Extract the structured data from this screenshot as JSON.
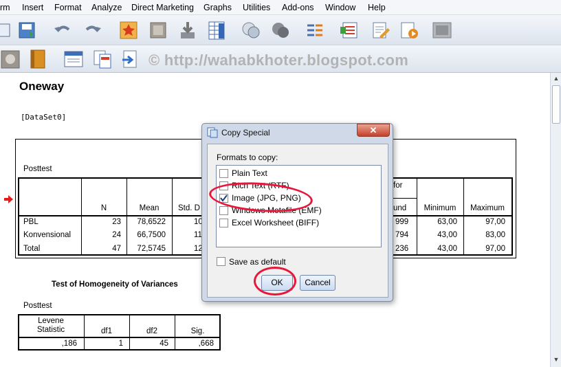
{
  "menu": [
    "rm",
    "Insert",
    "Format",
    "Analyze",
    "Direct Marketing",
    "Graphs",
    "Utilities",
    "Add-ons",
    "Window",
    "Help"
  ],
  "watermark": "© http://wahabkhoter.blogspot.com",
  "output": {
    "heading": "Oneway",
    "dataset": "[DataSet0]",
    "desc_table": {
      "title": "Posttest",
      "header_visible": [
        "N",
        "Mean",
        "Std. D",
        "for",
        "und",
        "Minimum",
        "Maximum"
      ],
      "rows": [
        {
          "label": "PBL",
          "n": "23",
          "mean": "78,6522",
          "std": "10",
          "upper": "999",
          "min": "63,00",
          "max": "97,00"
        },
        {
          "label": "Konvensional",
          "n": "24",
          "mean": "66,7500",
          "std": "11",
          "upper": "794",
          "min": "43,00",
          "max": "83,00"
        },
        {
          "label": "Total",
          "n": "47",
          "mean": "72,5745",
          "std": "12",
          "upper": "236",
          "min": "43,00",
          "max": "97,00"
        }
      ]
    },
    "homog": {
      "heading": "Test of Homogeneity of Variances",
      "title": "Posttest",
      "headers": [
        "Levene\nStatistic",
        "df1",
        "df2",
        "Sig."
      ],
      "row": [
        ",186",
        "1",
        "45",
        ",668"
      ]
    }
  },
  "dialog": {
    "title": "Copy Special",
    "close": "✕",
    "formats_label": "Formats to copy:",
    "formats": [
      {
        "label": "Plain Text",
        "checked": false
      },
      {
        "label": "Rich Text (RTF)",
        "checked": false
      },
      {
        "label": "Image (JPG, PNG)",
        "checked": true
      },
      {
        "label": "Windows Metafile (EMF)",
        "checked": false
      },
      {
        "label": "Excel Worksheet (BIFF)",
        "checked": false
      }
    ],
    "save_default": "Save as default",
    "ok": "OK",
    "cancel": "Cancel"
  },
  "colors": {
    "annotation": "#e8163b",
    "accent": "#3b6fb6"
  }
}
